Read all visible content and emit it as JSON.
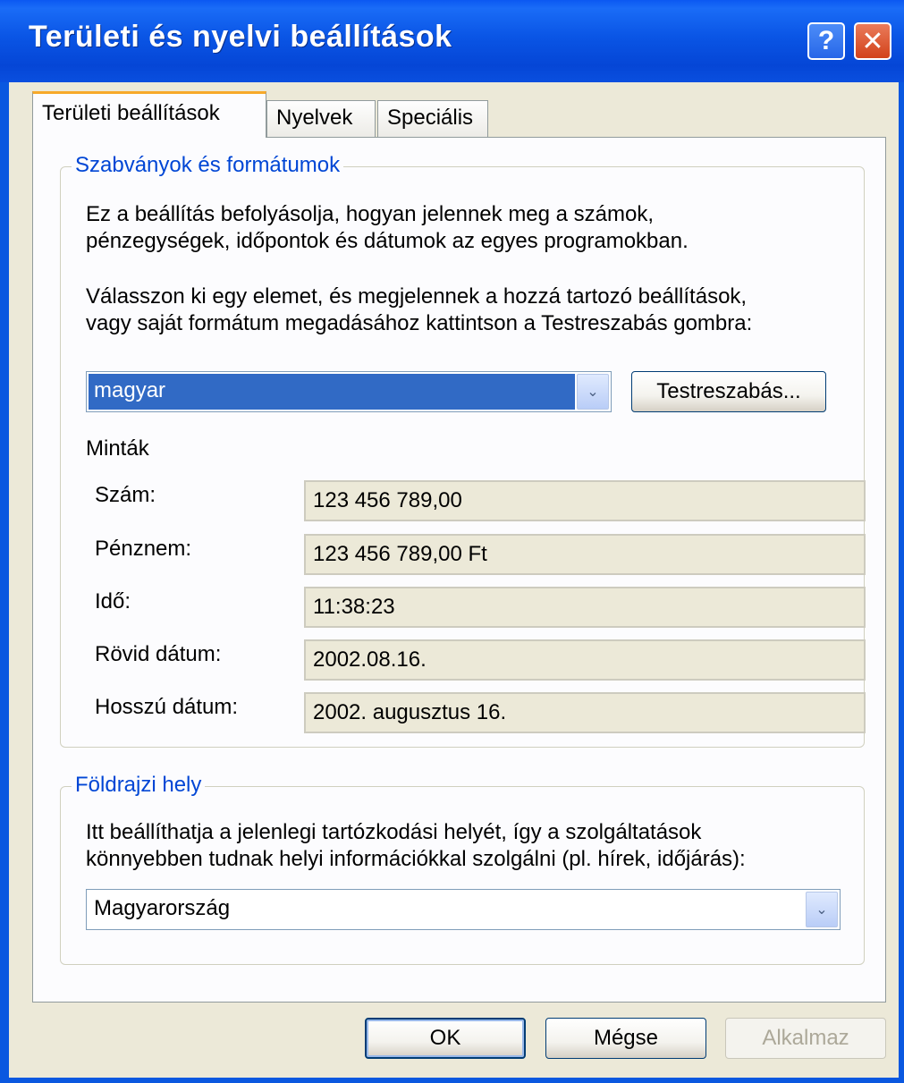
{
  "window": {
    "title": "Területi és nyelvi beállítások"
  },
  "tabs": {
    "regional": "Területi beállítások",
    "languages": "Nyelvek",
    "advanced": "Speciális"
  },
  "standards": {
    "legend": "Szabványok és formátumok",
    "desc_line1": "Ez a beállítás befolyásolja, hogyan jelennek meg a számok,",
    "desc_line2": "pénzegységek, időpontok és dátumok az egyes programokban.",
    "instr_line1": "Válasszon ki egy elemet, és megjelennek a hozzá tartozó beállítások,",
    "instr_line2": "vagy saját formátum megadásához kattintson a Testreszabás gombra:",
    "locale_value": "magyar",
    "customize_label": "Testreszabás...",
    "samples_heading": "Minták",
    "samples": [
      {
        "label": "Szám:",
        "value": "123 456 789,00"
      },
      {
        "label": "Pénznem:",
        "value": "123 456 789,00 Ft"
      },
      {
        "label": "Idő:",
        "value": "11:38:23"
      },
      {
        "label": "Rövid dátum:",
        "value": "2002.08.16."
      },
      {
        "label": "Hosszú dátum:",
        "value": "2002. augusztus 16."
      }
    ]
  },
  "location": {
    "legend": "Földrajzi hely",
    "desc_line1": "Itt beállíthatja a jelenlegi tartózkodási helyét, így a szolgáltatások",
    "desc_line2": "könnyebben tudnak helyi információkkal szolgálni (pl. hírek, időjárás):",
    "value": "Magyarország"
  },
  "buttons": {
    "ok": "OK",
    "cancel": "Mégse",
    "apply": "Alkalmaz"
  },
  "icons": {
    "help": "?",
    "close": "✕",
    "dropdown": "⌄"
  }
}
